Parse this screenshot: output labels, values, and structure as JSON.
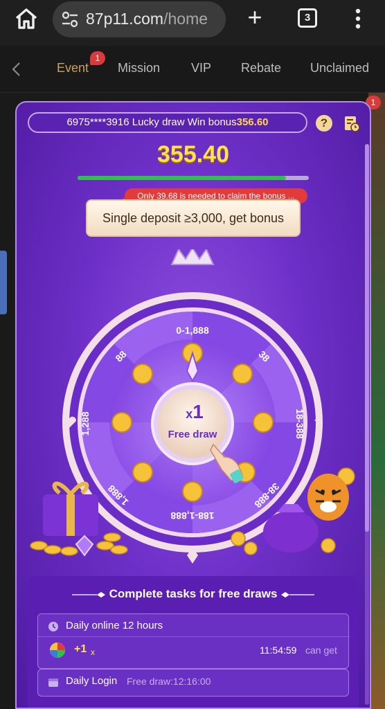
{
  "browser": {
    "url_main": "87p11.com",
    "url_path": "/home",
    "tab_count": "3",
    "new_tab_label": "+"
  },
  "nav": {
    "tabs": [
      {
        "label": "Event",
        "active": true
      },
      {
        "label": "Mission"
      },
      {
        "label": "VIP"
      },
      {
        "label": "Rebate"
      },
      {
        "label": "Unclaimed"
      }
    ],
    "event_badge": "1",
    "corner_badge": "1"
  },
  "modal": {
    "marquee_prefix": "6975****3916 Lucky draw Win bonus",
    "marquee_amount": "356.60",
    "help_label": "?",
    "amount": "355.40",
    "progress_percent": 90,
    "tooltip": "Only 39.68 is needed to claim the bonus ...",
    "deposit_text": "Single deposit ≥3,000, get bonus",
    "wheel": {
      "multiplier": "1",
      "x_label": "x",
      "center_label": "Free draw",
      "segments": [
        "0-1,888",
        "38",
        "18-388",
        "38-888",
        "188-1,888",
        "1,888",
        "1,288",
        "88"
      ]
    }
  },
  "tasks": {
    "title": "Complete tasks for free draws",
    "items": [
      {
        "label": "Daily online 12 hours",
        "reward": "+1",
        "reward_x": "x",
        "timer": "11:54:59",
        "status": "can get"
      },
      {
        "label": "Daily Login",
        "note": "Free draw:12:16:00"
      }
    ]
  },
  "colors": {
    "accent_gold": "#ffe34a",
    "modal_purple": "#6e30c8",
    "progress_green": "#2ec24a",
    "alert_red": "#e23b3b"
  }
}
